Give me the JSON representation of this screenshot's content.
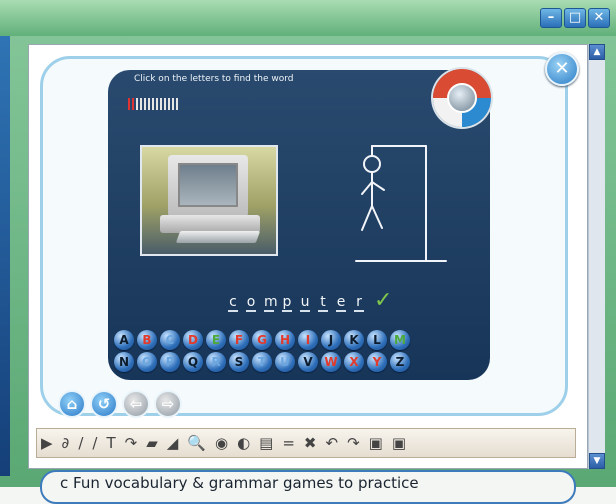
{
  "window": {
    "minimize": "–",
    "maximize": "□",
    "close": "✕"
  },
  "game": {
    "instruction": "Click on the letters to find the word",
    "word_letters": [
      "c",
      "o",
      "m",
      "p",
      "u",
      "t",
      "e",
      "r"
    ],
    "checkmark": "✓",
    "guess_counter": {
      "total": 13,
      "used": 2
    }
  },
  "keyboard": {
    "row1": [
      {
        "letter": "A",
        "state": "available"
      },
      {
        "letter": "B",
        "state": "used-red"
      },
      {
        "letter": "C",
        "state": "used-blue"
      },
      {
        "letter": "D",
        "state": "used-red"
      },
      {
        "letter": "E",
        "state": "used-green"
      },
      {
        "letter": "F",
        "state": "used-red"
      },
      {
        "letter": "G",
        "state": "used-red"
      },
      {
        "letter": "H",
        "state": "used-red"
      },
      {
        "letter": "I",
        "state": "used-red"
      },
      {
        "letter": "J",
        "state": "available"
      },
      {
        "letter": "K",
        "state": "available"
      },
      {
        "letter": "L",
        "state": "available"
      },
      {
        "letter": "M",
        "state": "used-green"
      }
    ],
    "row2": [
      {
        "letter": "N",
        "state": "available"
      },
      {
        "letter": "O",
        "state": "used-blue"
      },
      {
        "letter": "P",
        "state": "used-blue"
      },
      {
        "letter": "Q",
        "state": "available"
      },
      {
        "letter": "R",
        "state": "used-blue"
      },
      {
        "letter": "S",
        "state": "available"
      },
      {
        "letter": "T",
        "state": "used-blue"
      },
      {
        "letter": "U",
        "state": "used-blue"
      },
      {
        "letter": "V",
        "state": "available"
      },
      {
        "letter": "W",
        "state": "used-red"
      },
      {
        "letter": "X",
        "state": "used-red"
      },
      {
        "letter": "Y",
        "state": "used-red"
      },
      {
        "letter": "Z",
        "state": "available"
      }
    ]
  },
  "nav": {
    "home": "⌂",
    "replay": "↺",
    "back": "⇦",
    "forward": "⇨"
  },
  "toolbar": {
    "tools": [
      {
        "name": "pointer-tool",
        "glyph": "▶"
      },
      {
        "name": "lasso-tool",
        "glyph": "∂"
      },
      {
        "name": "pen-tool",
        "glyph": "/"
      },
      {
        "name": "highlighter-tool",
        "glyph": "/"
      },
      {
        "name": "text-tool",
        "glyph": "T"
      },
      {
        "name": "curve-tool",
        "glyph": "↷"
      },
      {
        "name": "fill-tool",
        "glyph": "▰"
      },
      {
        "name": "eraser-tool",
        "glyph": "◢"
      },
      {
        "name": "magnifier-tool",
        "glyph": "🔍"
      },
      {
        "name": "spotlight-tool",
        "glyph": "◉"
      },
      {
        "name": "reveal-tool",
        "glyph": "◐"
      },
      {
        "name": "screen-tool",
        "glyph": "▤"
      },
      {
        "name": "separator-tool",
        "glyph": "="
      },
      {
        "name": "delete-tool",
        "glyph": "✖"
      },
      {
        "name": "undo-tool",
        "glyph": "↶"
      },
      {
        "name": "redo-tool",
        "glyph": "↷"
      },
      {
        "name": "save-tool",
        "glyph": "▣"
      },
      {
        "name": "print-tool",
        "glyph": "▣"
      }
    ]
  },
  "caption": "c    Fun vocabulary & grammar games to practice"
}
